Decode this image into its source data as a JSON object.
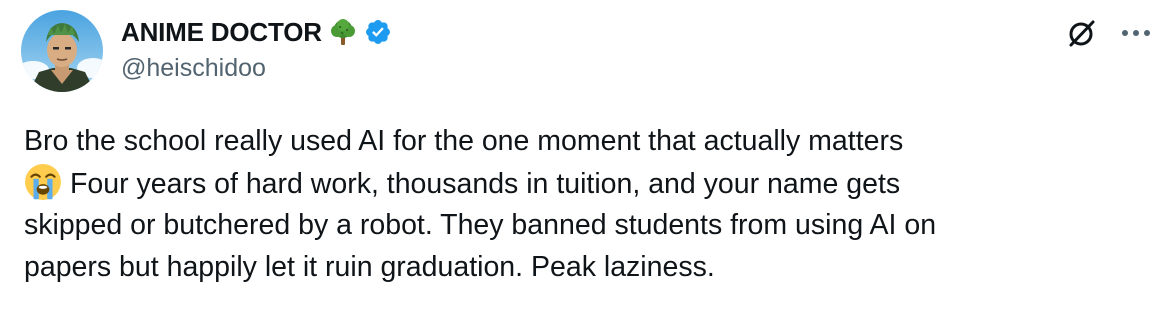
{
  "author": {
    "display_name": "ANIME DOCTOR",
    "handle": "@heischidoo",
    "badge_emoji": "tree-emoji",
    "verified": true,
    "verified_color": "#1d9bf0"
  },
  "toolbar": {
    "grok_icon": "grok-icon",
    "more_icon": "more-options-icon"
  },
  "tweet": {
    "lines": [
      "Bro the school really used AI for the one moment that actually matters",
      "Four years of hard work, thousands in tuition, and your name gets",
      "skipped or butchered by a robot. They banned students from using AI on",
      "papers but happily let it ruin graduation. Peak laziness."
    ],
    "line2_leading_emoji": "loudly-crying-face-emoji"
  },
  "colors": {
    "text_primary": "#0f1419",
    "text_secondary": "#536471",
    "accent": "#1d9bf0"
  }
}
